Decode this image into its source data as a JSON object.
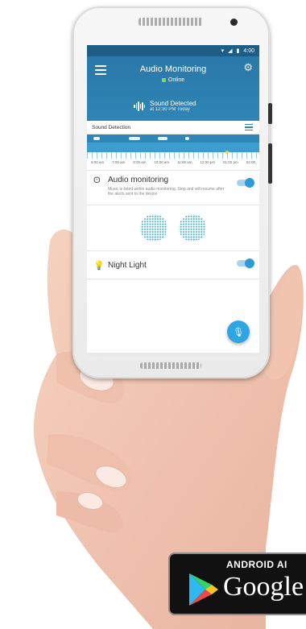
{
  "status_bar": {
    "time": "4:00",
    "icons": [
      "wifi-icon",
      "signal-icon",
      "battery-icon"
    ]
  },
  "app_bar": {
    "title": "Audio Monitoring",
    "status": "Online",
    "menu_icon": "menu-icon",
    "settings_icon": "gear-icon"
  },
  "alert": {
    "title": "Sound Detected",
    "subtitle": "at 12:30 PM Today",
    "icon": "sound-wave-icon"
  },
  "detection": {
    "header": "Sound Detection",
    "list_icon": "list-icon",
    "time_labels": [
      "9:00 am",
      "7:00 am",
      "8:00 am",
      "10:00 am",
      "11:00 am",
      "12:00 pm",
      "01:00 pm",
      "02:00"
    ]
  },
  "audio_monitoring": {
    "label": "Audio monitoring",
    "description": "Music is listed within audio monitoring. Stop and will resume after the alerts sent to the device",
    "enabled": true
  },
  "night_light": {
    "label": "Night Light",
    "enabled": true
  },
  "fab_icon": "microphone-icon",
  "badge": {
    "line1": "ANDROID AI",
    "line2": "Google"
  },
  "colors": {
    "primary": "#2e86b6",
    "accent": "#2ea6e4",
    "online": "#7ddc4d",
    "viz": "#46b3c7"
  }
}
